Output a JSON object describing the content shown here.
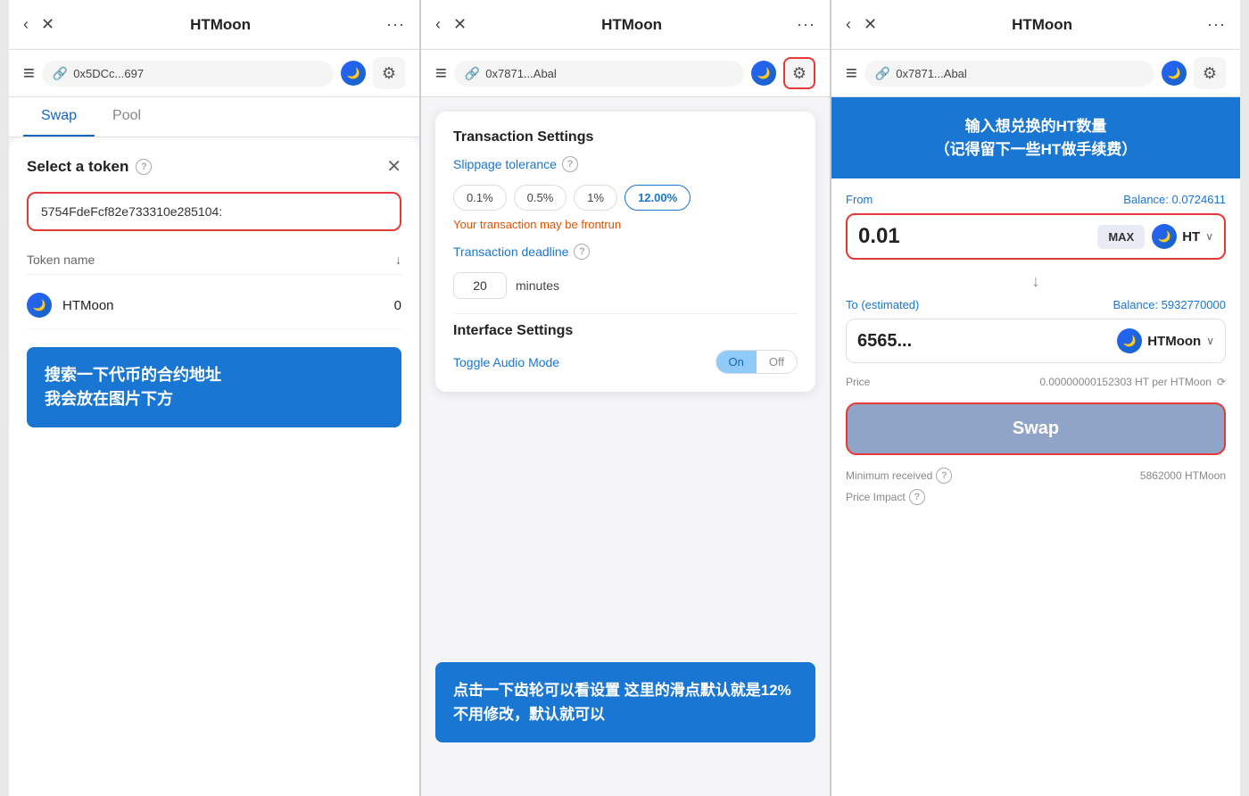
{
  "panels": [
    {
      "id": "panel1",
      "topbar": {
        "back_label": "‹",
        "close_label": "✕",
        "title": "HTMoon",
        "more_label": "···"
      },
      "addressbar": {
        "address": "0x5DCc...697",
        "hamburger": "≡"
      },
      "tabs": [
        {
          "label": "Swap",
          "active": true
        },
        {
          "label": "Pool",
          "active": false
        }
      ],
      "modal": {
        "title": "Select a token",
        "help": "?",
        "close": "✕",
        "search_placeholder": "5754FdeFcf82e733310e285104...",
        "search_value": "5754FdeFcf82e733310e285104:",
        "list_header": "Token name",
        "tokens": [
          {
            "name": "HTMoon",
            "balance": "0"
          }
        ]
      },
      "annotation": {
        "text": "搜索一下代币的合约地址\n我会放在图片下方"
      }
    },
    {
      "id": "panel2",
      "topbar": {
        "back_label": "‹",
        "close_label": "✕",
        "title": "HTMoon",
        "more_label": "···"
      },
      "addressbar": {
        "address": "0x7871...Abal",
        "hamburger": "≡"
      },
      "settings": {
        "transaction_title": "Transaction Settings",
        "slippage_label": "Slippage tolerance",
        "slippage_options": [
          "0.1%",
          "0.5%",
          "1%",
          "12.00%"
        ],
        "slippage_active": 3,
        "warning": "Your transaction may be frontrun",
        "deadline_label": "Transaction deadline",
        "deadline_value": "20",
        "deadline_unit": "minutes",
        "interface_title": "Interface Settings",
        "audio_label": "Toggle Audio Mode",
        "toggle_on": "On",
        "toggle_off": "Off"
      },
      "annotation": {
        "text": "点击一下齿轮可以看设置\n这里的滑点默认就是12%\n不用修改，默认就可以"
      }
    },
    {
      "id": "panel3",
      "topbar": {
        "back_label": "‹",
        "close_label": "✕",
        "title": "HTMoon",
        "more_label": "···"
      },
      "addressbar": {
        "address": "0x7871...Abal",
        "hamburger": "≡"
      },
      "swap": {
        "header_text": "输入想兑换的HT数量\n（记得留下一些HT做手续费）",
        "from_label": "From",
        "balance_label": "Balance: 0.0724611",
        "from_amount": "0.01",
        "max_label": "MAX",
        "from_token": "HT",
        "arrow": "↓",
        "to_label": "To (estimated)",
        "to_balance": "Balance: 5932770000",
        "to_amount": "6565...",
        "to_token": "HTMoon",
        "price_label": "Price",
        "price_value": "0.00000000152303 HT per HTMoon",
        "swap_label": "Swap",
        "min_received_label": "Minimum received",
        "min_received_help": "?",
        "min_received_value": "5862000 HTMoon",
        "price_impact_label": "Price Impact",
        "price_impact_help": "?"
      }
    }
  ]
}
